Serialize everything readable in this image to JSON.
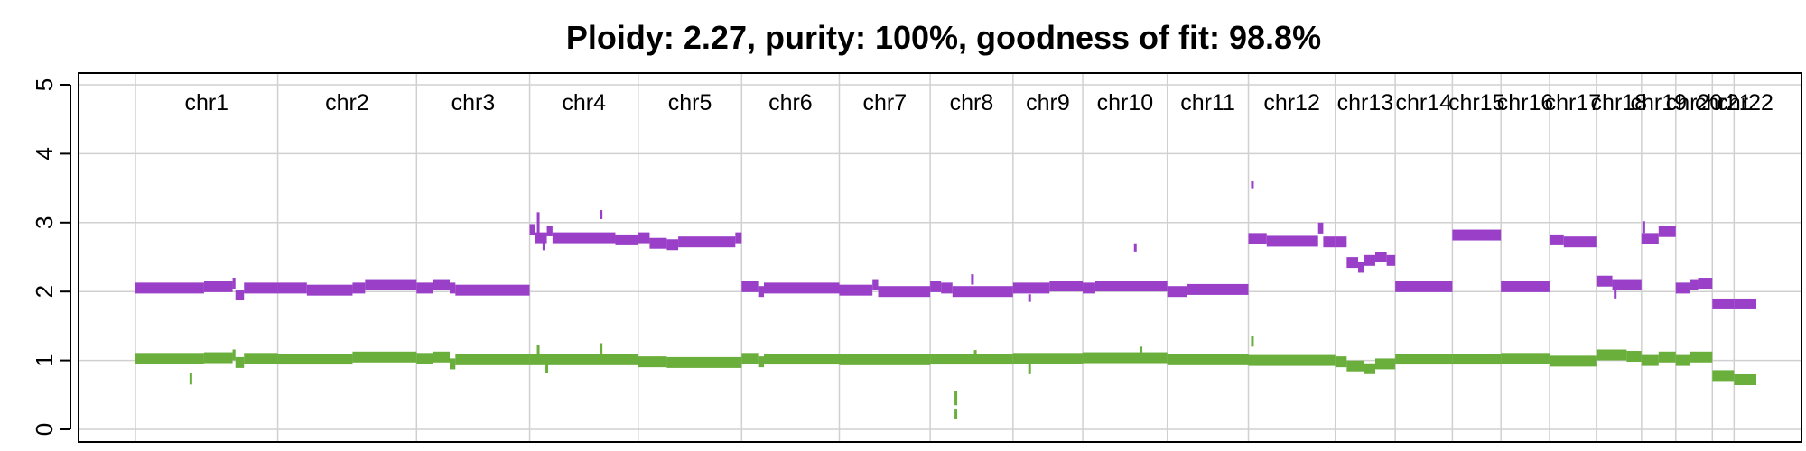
{
  "chart_data": {
    "type": "line",
    "title": "Ploidy: 2.27, purity: 100%, goodness of fit: 98.8%",
    "xlabel": "",
    "ylabel": "",
    "ylim": [
      0,
      5
    ],
    "yticks": [
      "0",
      "1",
      "2",
      "3",
      "4",
      "5"
    ],
    "grid": true,
    "chromosomes": [
      {
        "name": "chr1",
        "start": 0,
        "end": 249
      },
      {
        "name": "chr2",
        "start": 249,
        "end": 492
      },
      {
        "name": "chr3",
        "start": 492,
        "end": 690
      },
      {
        "name": "chr4",
        "start": 690,
        "end": 880
      },
      {
        "name": "chr5",
        "start": 880,
        "end": 1061
      },
      {
        "name": "chr6",
        "start": 1061,
        "end": 1232
      },
      {
        "name": "chr7",
        "start": 1232,
        "end": 1391
      },
      {
        "name": "chr8",
        "start": 1391,
        "end": 1536
      },
      {
        "name": "chr9",
        "start": 1536,
        "end": 1658
      },
      {
        "name": "chr10",
        "start": 1658,
        "end": 1806
      },
      {
        "name": "chr11",
        "start": 1806,
        "end": 1948
      },
      {
        "name": "chr12",
        "start": 1948,
        "end": 2100
      },
      {
        "name": "chr13",
        "start": 2100,
        "end": 2205
      },
      {
        "name": "chr14",
        "start": 2205,
        "end": 2305
      },
      {
        "name": "chr15",
        "start": 2305,
        "end": 2390
      },
      {
        "name": "chr16",
        "start": 2390,
        "end": 2475
      },
      {
        "name": "chr17",
        "start": 2475,
        "end": 2557
      },
      {
        "name": "chr18",
        "start": 2557,
        "end": 2636
      },
      {
        "name": "chr19",
        "start": 2636,
        "end": 2696
      },
      {
        "name": "chr20",
        "start": 2696,
        "end": 2760
      },
      {
        "name": "chr21",
        "start": 2760,
        "end": 2798
      },
      {
        "name": "chr22",
        "start": 2798,
        "end": 2837
      }
    ],
    "series": [
      {
        "color": "#9a40c8",
        "segments": [
          [
            0,
            120,
            2.05
          ],
          [
            120,
            170,
            2.07
          ],
          [
            170,
            175,
            2.12
          ],
          [
            175,
            190,
            1.95
          ],
          [
            190,
            249,
            2.05
          ],
          [
            249,
            300,
            2.05
          ],
          [
            300,
            380,
            2.02
          ],
          [
            380,
            402,
            2.05
          ],
          [
            402,
            492,
            2.1
          ],
          [
            492,
            520,
            2.05
          ],
          [
            520,
            550,
            2.1
          ],
          [
            550,
            560,
            2.05
          ],
          [
            560,
            690,
            2.02
          ],
          [
            690,
            700,
            2.9
          ],
          [
            700,
            720,
            2.78
          ],
          [
            720,
            730,
            2.88
          ],
          [
            730,
            840,
            2.78
          ],
          [
            840,
            880,
            2.75
          ],
          [
            880,
            900,
            2.78
          ],
          [
            900,
            930,
            2.7
          ],
          [
            930,
            950,
            2.68
          ],
          [
            950,
            1050,
            2.72
          ],
          [
            1050,
            1061,
            2.78
          ],
          [
            1061,
            1090,
            2.07
          ],
          [
            1090,
            1100,
            2.0
          ],
          [
            1100,
            1232,
            2.05
          ],
          [
            1232,
            1290,
            2.02
          ],
          [
            1290,
            1300,
            2.1
          ],
          [
            1300,
            1391,
            2.0
          ],
          [
            1391,
            1410,
            2.07
          ],
          [
            1410,
            1430,
            2.05
          ],
          [
            1430,
            1536,
            2.0
          ],
          [
            1536,
            1600,
            2.05
          ],
          [
            1600,
            1658,
            2.08
          ],
          [
            1658,
            1680,
            2.05
          ],
          [
            1680,
            1806,
            2.08
          ],
          [
            1806,
            1840,
            2.0
          ],
          [
            1840,
            1948,
            2.03
          ],
          [
            1948,
            1980,
            2.77
          ],
          [
            1980,
            2070,
            2.73
          ],
          [
            2070,
            2079,
            2.92
          ],
          [
            2079,
            2100,
            2.72
          ],
          [
            2100,
            2120,
            2.72
          ],
          [
            2120,
            2140,
            2.42
          ],
          [
            2140,
            2150,
            2.35
          ],
          [
            2150,
            2170,
            2.45
          ],
          [
            2170,
            2190,
            2.5
          ],
          [
            2190,
            2205,
            2.45
          ],
          [
            2205,
            2305,
            2.07
          ],
          [
            2305,
            2390,
            2.82
          ],
          [
            2390,
            2475,
            2.07
          ],
          [
            2475,
            2500,
            2.75
          ],
          [
            2500,
            2557,
            2.72
          ],
          [
            2557,
            2585,
            2.15
          ],
          [
            2585,
            2636,
            2.1
          ],
          [
            2636,
            2666,
            2.77
          ],
          [
            2666,
            2696,
            2.87
          ],
          [
            2696,
            2720,
            2.05
          ],
          [
            2720,
            2735,
            2.1
          ],
          [
            2735,
            2760,
            2.12
          ],
          [
            2760,
            2798,
            1.82
          ],
          [
            2798,
            2837,
            1.82
          ]
        ],
        "spikes": [
          [
            705,
            3.15,
            2.85
          ],
          [
            715,
            2.6,
            2.75
          ],
          [
            815,
            3.18,
            3.05
          ],
          [
            1955,
            3.6,
            3.5
          ],
          [
            1750,
            2.7,
            2.58
          ],
          [
            1465,
            2.25,
            2.1
          ],
          [
            1565,
            1.85,
            1.96
          ],
          [
            2640,
            3.02,
            2.85
          ],
          [
            2590,
            1.9,
            2.02
          ]
        ]
      },
      {
        "color": "#6aae3c",
        "segments": [
          [
            0,
            120,
            1.03
          ],
          [
            120,
            170,
            1.04
          ],
          [
            170,
            175,
            1.08
          ],
          [
            175,
            190,
            0.97
          ],
          [
            190,
            249,
            1.03
          ],
          [
            249,
            380,
            1.02
          ],
          [
            380,
            492,
            1.05
          ],
          [
            492,
            520,
            1.03
          ],
          [
            520,
            550,
            1.05
          ],
          [
            550,
            560,
            0.95
          ],
          [
            560,
            690,
            1.01
          ],
          [
            690,
            880,
            1.01
          ],
          [
            880,
            930,
            0.98
          ],
          [
            930,
            1061,
            0.97
          ],
          [
            1061,
            1090,
            1.03
          ],
          [
            1090,
            1100,
            0.98
          ],
          [
            1100,
            1232,
            1.02
          ],
          [
            1232,
            1391,
            1.01
          ],
          [
            1391,
            1536,
            1.02
          ],
          [
            1536,
            1658,
            1.03
          ],
          [
            1658,
            1806,
            1.04
          ],
          [
            1806,
            1948,
            1.01
          ],
          [
            1948,
            2100,
            1.0
          ],
          [
            2100,
            2120,
            0.98
          ],
          [
            2120,
            2150,
            0.92
          ],
          [
            2150,
            2170,
            0.88
          ],
          [
            2170,
            2205,
            0.95
          ],
          [
            2205,
            2305,
            1.02
          ],
          [
            2305,
            2390,
            1.02
          ],
          [
            2390,
            2475,
            1.03
          ],
          [
            2475,
            2557,
            0.99
          ],
          [
            2557,
            2610,
            1.08
          ],
          [
            2610,
            2636,
            1.06
          ],
          [
            2636,
            2666,
            1.0
          ],
          [
            2666,
            2696,
            1.05
          ],
          [
            2696,
            2720,
            1.0
          ],
          [
            2720,
            2760,
            1.05
          ],
          [
            2760,
            2798,
            0.78
          ],
          [
            2798,
            2837,
            0.72
          ]
        ],
        "spikes": [
          [
            97,
            0.65,
            0.82
          ],
          [
            705,
            1.22,
            1.05
          ],
          [
            720,
            0.82,
            0.95
          ],
          [
            815,
            1.25,
            1.1
          ],
          [
            1436,
            0.55,
            0.35
          ],
          [
            1436,
            0.3,
            0.15
          ],
          [
            1565,
            0.8,
            0.95
          ],
          [
            1955,
            1.35,
            1.2
          ],
          [
            1760,
            1.2,
            1.05
          ],
          [
            1470,
            1.15,
            1.02
          ]
        ]
      }
    ]
  }
}
